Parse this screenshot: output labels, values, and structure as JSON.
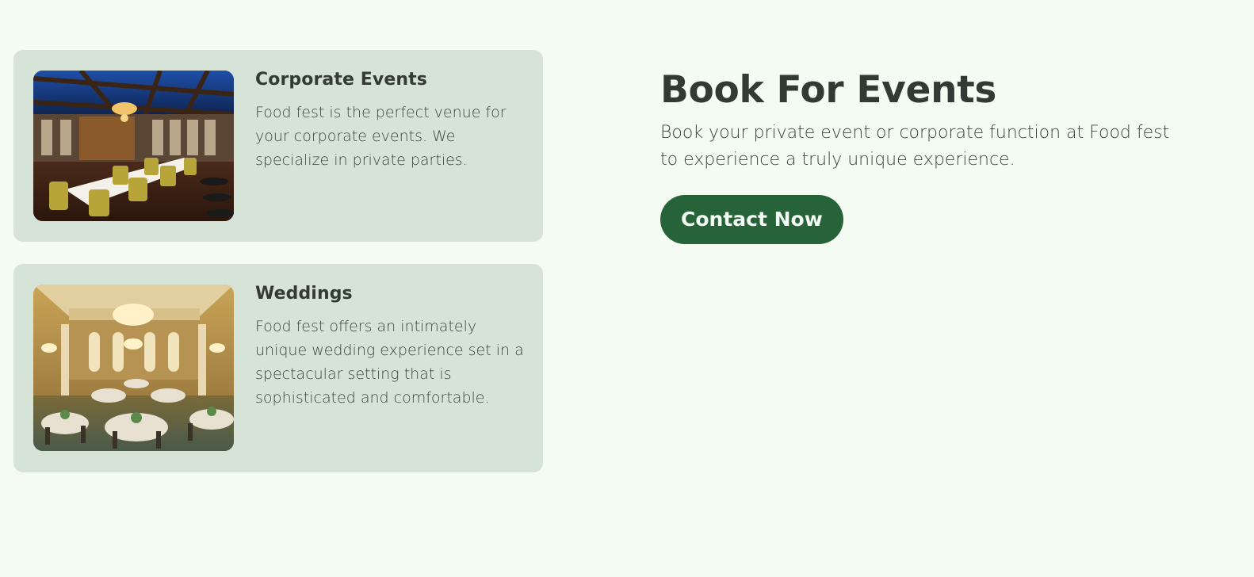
{
  "cards": [
    {
      "title": "Corporate Events",
      "description": "Food fest is the perfect venue for your corporate events. We specialize in private parties.",
      "image_alt": "Restaurant dining room with long table and yellow chairs under a glass roof"
    },
    {
      "title": "Weddings",
      "description": "Food fest offers an intimately unique wedding experience set in a spectacular setting that is sophisticated and comfortable.",
      "image_alt": "Banquet hall with chandeliers and round tables"
    }
  ],
  "promo": {
    "title": "Book For Events",
    "text": "Book your private event or corporate function at Food fest to experience a truly unique experience.",
    "button_label": "Contact Now"
  },
  "colors": {
    "page_background": "#f3fbf2",
    "card_background": "#d6e4d7",
    "button_background": "#276339",
    "button_text": "#f4faf4",
    "heading_text": "#333a35"
  }
}
